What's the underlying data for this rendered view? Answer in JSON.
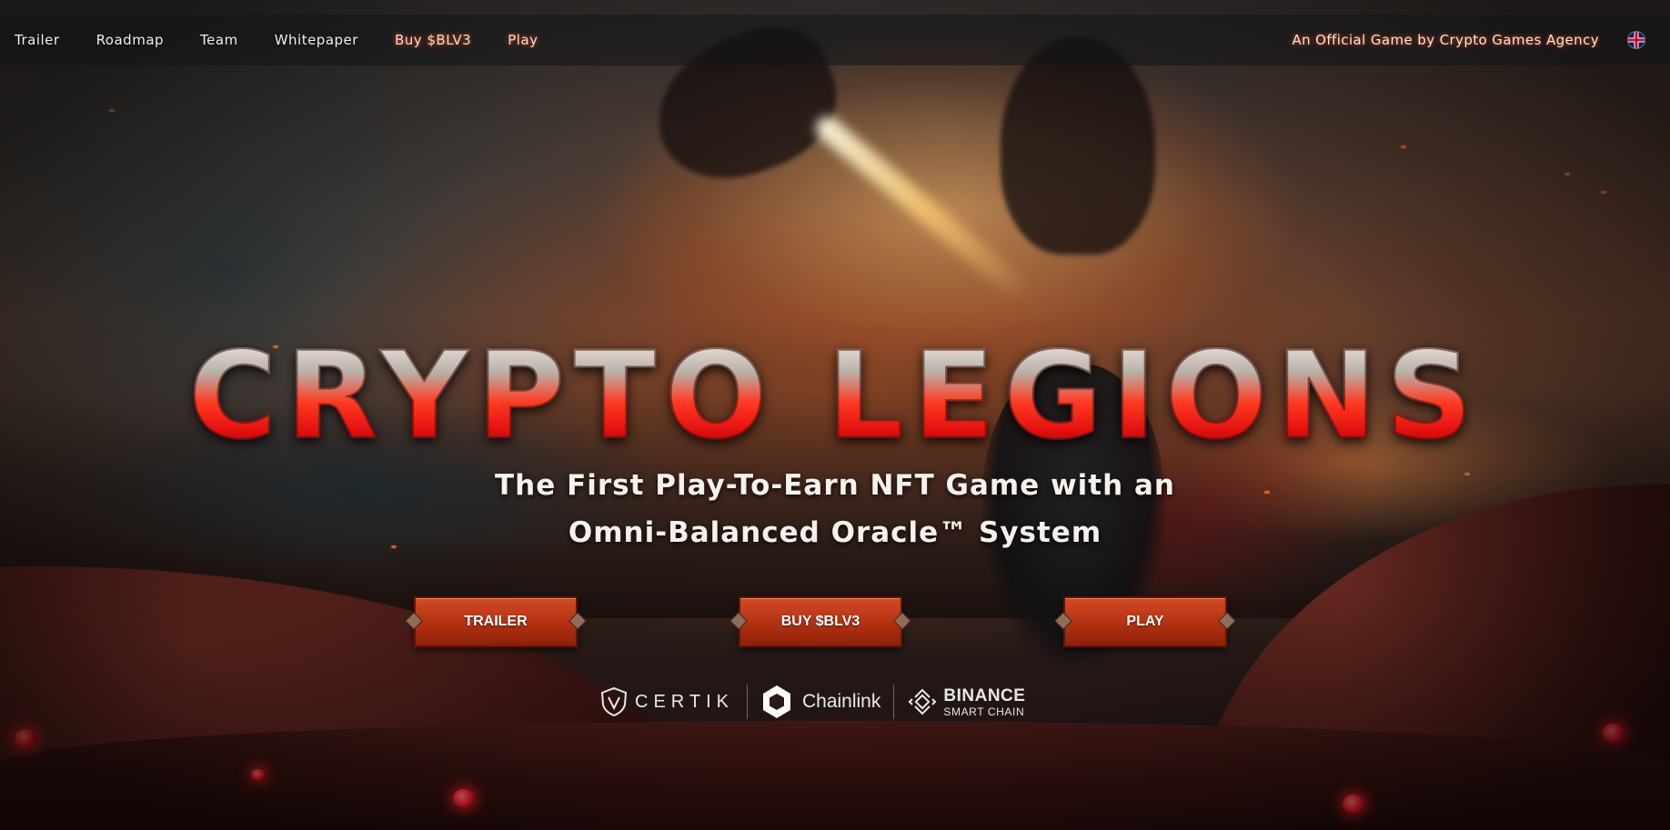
{
  "nav": {
    "links": [
      {
        "label": "Trailer"
      },
      {
        "label": "Roadmap"
      },
      {
        "label": "Team"
      },
      {
        "label": "Whitepaper"
      },
      {
        "label": "Buy $BLV3"
      },
      {
        "label": "Play"
      }
    ],
    "official_text": "An Official Game by Crypto Games Agency",
    "language_icon": "uk-flag-icon"
  },
  "hero": {
    "logo_text": "CRYPTO LEGIONS",
    "tagline_line1": "The First Play-To-Earn NFT Game with an",
    "tagline_line2": "Omni-Balanced Oracle™ System",
    "buttons": {
      "trailer": "TRAILER",
      "buy": "BUY $BLV3",
      "play": "PLAY"
    }
  },
  "partners": {
    "certik": "CERTIK",
    "chainlink": "Chainlink",
    "binance_top": "BINANCE",
    "binance_bottom": "SMART CHAIN"
  },
  "colors": {
    "accent_red": "#e00d0d",
    "button_red": "#b23011",
    "gem_red": "#d6101c"
  }
}
